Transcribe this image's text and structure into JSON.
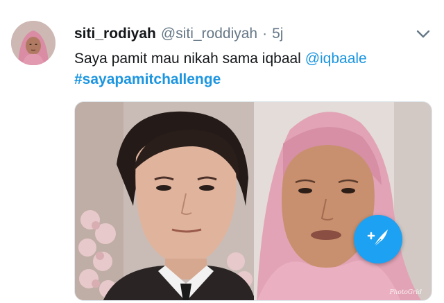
{
  "tweet": {
    "display_name": "siti_rodiyah",
    "handle": "@siti_roddiyah",
    "separator": "·",
    "time": "5j",
    "text_before_mention": "Saya pamit mau nikah sama iqbaal ",
    "mention": "@iqbaale",
    "hashtag": "#sayapamitchallenge"
  },
  "media": {
    "watermark": "PhotoGrid"
  },
  "icons": {
    "caret": "chevron-down-icon",
    "compose": "compose-feather-icon"
  },
  "colors": {
    "link_blue": "#1b95e0",
    "fab_blue": "#1da1f2",
    "secondary_text": "#657786",
    "primary_text": "#14171a"
  }
}
